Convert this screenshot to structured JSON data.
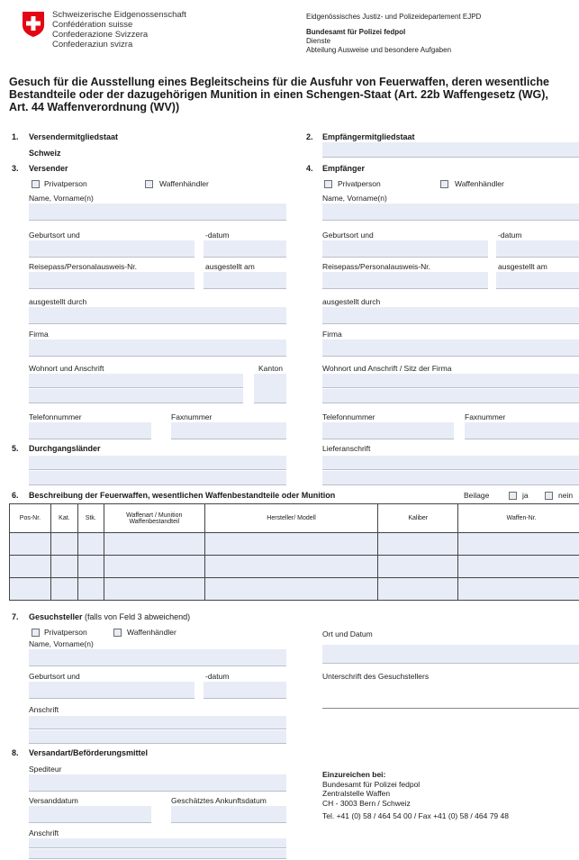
{
  "header": {
    "confed": [
      "Schweizerische Eidgenossenschaft",
      "Confédération suisse",
      "Confederazione Svizzera",
      "Confederaziun svizra"
    ],
    "department": "Eidgenössisches Justiz- und Polizeidepartement EJPD",
    "office": "Bundesamt für Polizei fedpol",
    "office_sub1": "Dienste",
    "office_sub2": "Abteilung Ausweise und besondere Aufgaben",
    "colors": {
      "flag": "#e30613",
      "field": "#e8ecf7"
    }
  },
  "title": {
    "line1": "Gesuch für die Ausstellung eines Begleitscheins für die Ausfuhr von Feuerwaffen, deren wesentliche",
    "line2": "Bestandteile oder der dazugehörigen Munition in einen Schengen-Staat (Art. 22b Waffengesetz (WG),",
    "line3": "Art. 44 Waffenverordnung (WV))"
  },
  "s1": {
    "num": "1.",
    "title": "Versendermitgliedstaat",
    "value": "Schweiz"
  },
  "s2": {
    "num": "2.",
    "title": "Empfängermitgliedstaat"
  },
  "s3": {
    "num": "3.",
    "title": "Versender"
  },
  "s4": {
    "num": "4.",
    "title": "Empfänger"
  },
  "s5": {
    "num": "5.",
    "title": "Durchgangsländer"
  },
  "s6": {
    "num": "6.",
    "title": "Beschreibung der Feuerwaffen, wesentlichen Waffenbestandteile oder Munition",
    "beilage": "Beilage",
    "ja": "ja",
    "nein": "nein"
  },
  "s7": {
    "num": "7.",
    "title": "Gesuchsteller",
    "note": "(falls von Feld 3 abweichend)"
  },
  "s8": {
    "num": "8.",
    "title": "Versandart/Beförderungsmittel"
  },
  "labels": {
    "privatperson": "Privatperson",
    "waffenhaendler": "Waffenhändler",
    "name": "Name, Vorname(n)",
    "geburtsort": "Geburtsort und",
    "datum": "-datum",
    "reisepass": "Reisepass/Personalausweis-Nr.",
    "ausgestellt_am": "ausgestellt am",
    "ausgestellt_durch": "ausgestellt durch",
    "firma": "Firma",
    "wohnort": "Wohnort und Anschrift",
    "kanton": "Kanton",
    "wohnort_sitz": "Wohnort und Anschrift / Sitz der Firma",
    "telefon": "Telefonnummer",
    "fax": "Faxnummer",
    "lieferanschrift": "Lieferanschrift",
    "anschrift": "Anschrift",
    "ort_datum": "Ort und Datum",
    "unterschrift": "Unterschrift des Gesuchstellers",
    "spediteur": "Spediteur",
    "versanddatum": "Versanddatum",
    "ankunftsdatum": "Geschätztes Ankunftsdatum"
  },
  "table": {
    "headers": [
      "Pos-Nr.",
      "Kat.",
      "Stk.",
      "Waffenart / Munition Waffenbestandteil",
      "Hersteller/ Modell",
      "Kaliber",
      "Waffen-Nr."
    ]
  },
  "submit": {
    "heading": "Einzureichen bei:",
    "line1": "Bundesamt für Polizei fedpol",
    "line2": "Zentralstelle Waffen",
    "line3": "CH - 3003 Bern / Schweiz",
    "phone": "Tel. +41 (0) 58 / 464 54 00 / Fax +41 (0) 58 / 464 79 48"
  }
}
